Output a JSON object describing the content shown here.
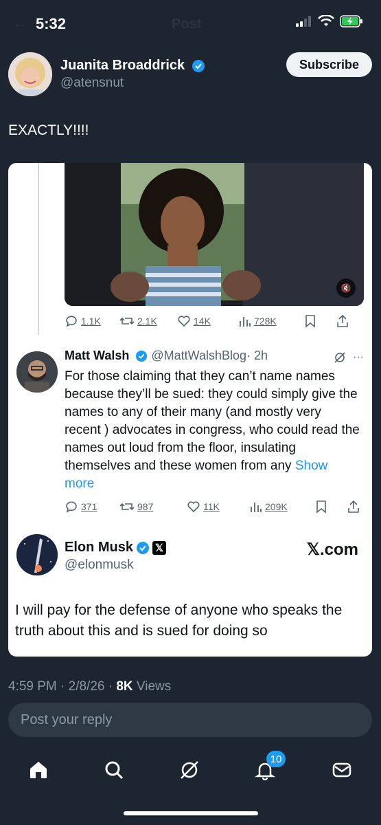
{
  "status": {
    "time": "5:32",
    "ghost_title": "Post",
    "battery_icon": "battery-charging-icon"
  },
  "post": {
    "author_name": "Juanita Broaddrick",
    "author_handle": "@atensnut",
    "subscribe_label": "Subscribe",
    "text": "EXACTLY!!!!",
    "meta_time": "4:59 PM · 2/8/26 · ",
    "views_count": "8K",
    "views_label": " Views"
  },
  "video_tweet": {
    "replies": "1.1K",
    "reposts": "2.1K",
    "likes": "14K",
    "views": "728K",
    "mute_icon": "speaker-muted-icon"
  },
  "reply_tweet": {
    "name": "Matt Walsh",
    "handle": "@MattWalshBlog",
    "time": "· 2h",
    "body": "For those claiming that they can’t name names because they’ll be sued: they could simply give the names to any of their many (and mostly very recent ) advocates in congress, who could read the names out loud from the floor, insulating themselves and these women from any ",
    "show_more": "Show more",
    "replies": "371",
    "reposts": "987",
    "likes": "11K",
    "views": "209K"
  },
  "quote": {
    "name": "Elon Musk",
    "handle": "@elonmusk",
    "site": "𝕏.com",
    "text": "I will pay for the defense of anyone who speaks the truth about this and is sued for doing so"
  },
  "composer": {
    "placeholder": "Post your reply"
  },
  "tabbar": {
    "notifications_badge": "10"
  },
  "colors": {
    "background": "#1c2530",
    "accent": "#1d9bf0",
    "muted": "#8b98a5"
  }
}
